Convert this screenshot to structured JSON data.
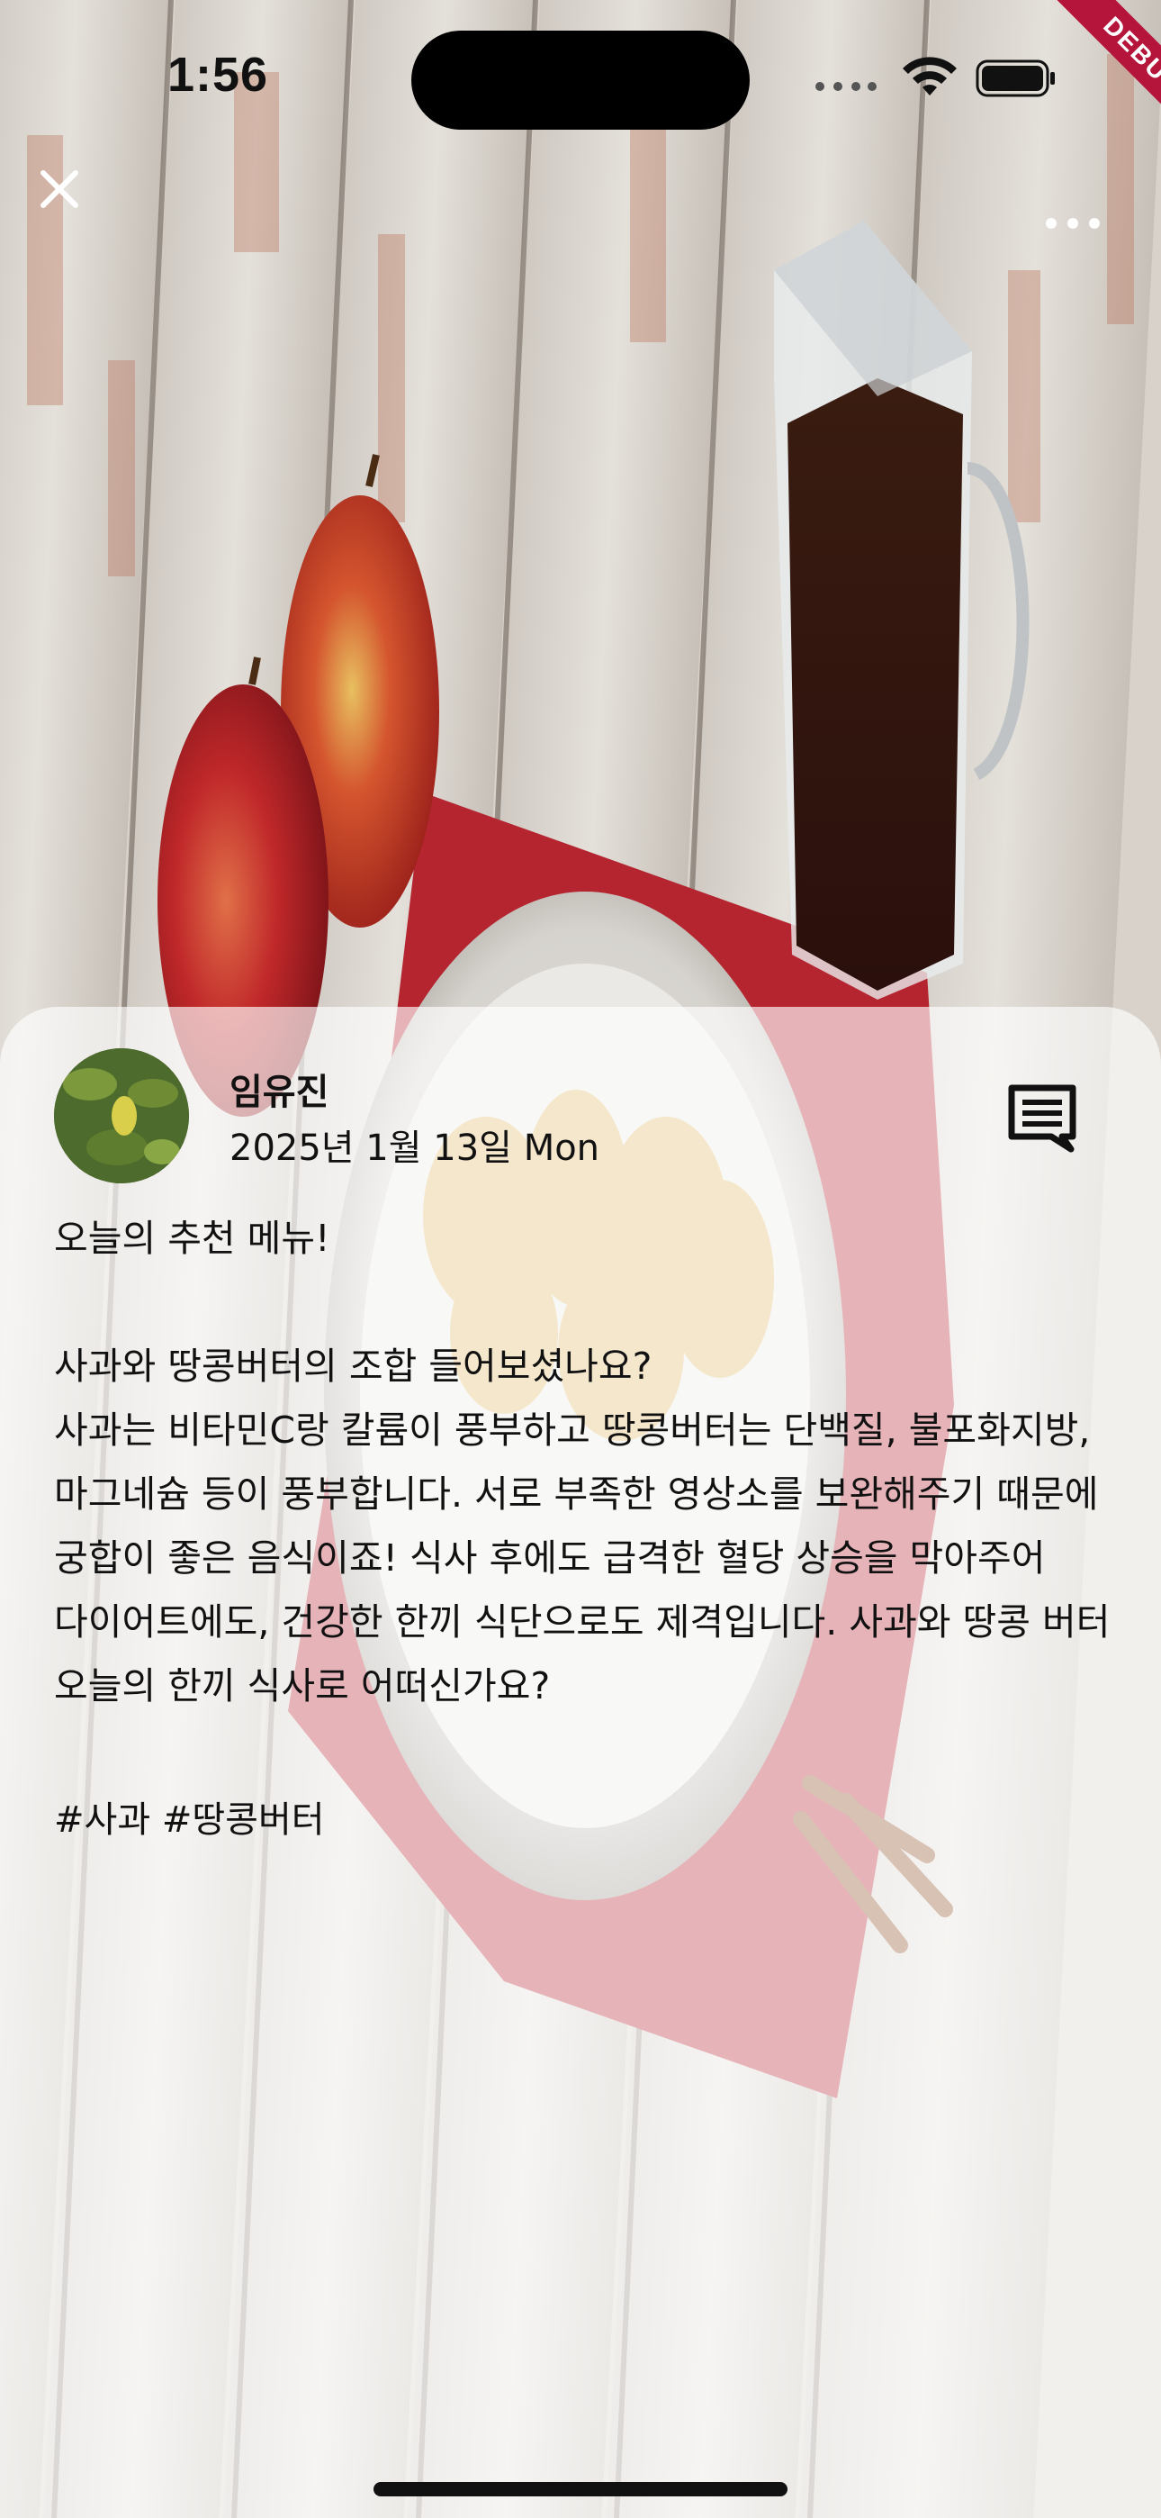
{
  "status_bar": {
    "time": "1:56",
    "debug_label": "DEBUG"
  },
  "post": {
    "author": "임유진",
    "date": "2025년 1월 13일 Mon",
    "body": "오늘의 추천 메뉴!\n\n사과와 땅콩버터의 조합 들어보셨나요?\n사과는 비타민C랑 칼륨이 풍부하고 땅콩버터는 단백질, 불포화지방, 마그네슘 등이 풍부합니다. 서로 부족한 영상소를 보완해주기 때문에 궁합이 좋은 음식이죠! 식사 후에도 급격한 혈당 상승을 막아주어 다이어트에도, 건강한 한끼 식단으로도 제격입니다. 사과와 땅콩 버터 오늘의 한끼 식사로 어떠신가요?",
    "hashtags": "#사과 #땅콩버터"
  },
  "icons": {
    "close": "close-icon",
    "more": "more-horizontal-icon",
    "comment": "comment-icon",
    "wifi": "wifi-icon",
    "battery": "battery-icon"
  }
}
